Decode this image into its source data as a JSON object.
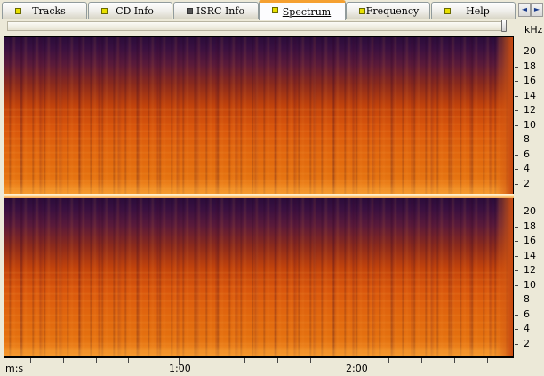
{
  "tabs": [
    {
      "label": "Tracks",
      "active": false,
      "icon": "yellow-square-icon"
    },
    {
      "label": "CD Info",
      "active": false,
      "icon": "yellow-square-icon"
    },
    {
      "label": "ISRC Info",
      "active": false,
      "icon": "grey-square-icon"
    },
    {
      "label": "Spectrum",
      "active": true,
      "icon": "yellow-square-icon"
    },
    {
      "label": "Frequency",
      "active": false,
      "icon": "yellow-square-icon"
    },
    {
      "label": "Help",
      "active": false,
      "icon": "yellow-square-icon"
    }
  ],
  "tab_scroll": {
    "left": "◄",
    "right": "►"
  },
  "spectrogram": {
    "unit": "kHz",
    "freq_labels": [
      "20",
      "18",
      "16",
      "14",
      "12",
      "10",
      "8",
      "6",
      "4",
      "2"
    ],
    "channels": 2,
    "colors": {
      "low": "#2a0c3a",
      "mid": "#c2430b",
      "high": "#f08820"
    }
  },
  "time_axis": {
    "labels": [
      "m:s",
      "1:00",
      "2:00"
    ]
  }
}
